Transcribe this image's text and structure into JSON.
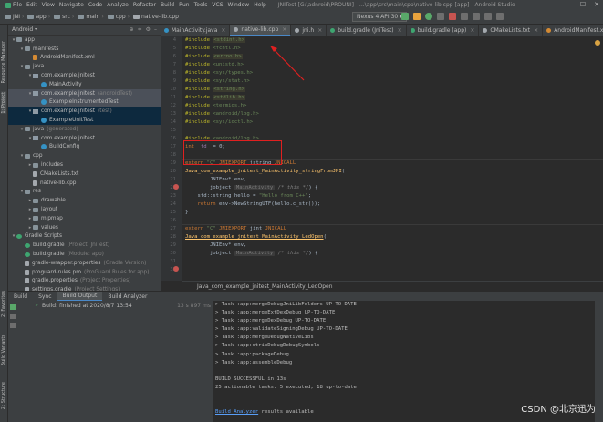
{
  "menubar": {
    "items": [
      "File",
      "Edit",
      "View",
      "Navigate",
      "Code",
      "Analyze",
      "Refactor",
      "Build",
      "Run",
      "Tools",
      "VCS",
      "Window",
      "Help"
    ],
    "title": "JNITest [G:\\adnroid\\PROUNI] - ...\\app\\src\\main\\cpp\\native-lib.cpp [app] - Android Studio"
  },
  "navbar": {
    "crumbs": [
      "JNI",
      "app",
      "src",
      "main",
      "cpp",
      "native-lib.cpp"
    ],
    "device": "Nexus 4 API 30 ▾"
  },
  "left_strip": [
    "Resource Manager",
    "1: Project",
    "2: Favorites",
    "Build Variants",
    "Z: Structure"
  ],
  "project": {
    "header": "Android ▾",
    "tree": [
      {
        "indent": 0,
        "arrow": "▾",
        "icon": "folder",
        "label": "app",
        "extra": ""
      },
      {
        "indent": 1,
        "arrow": "▾",
        "icon": "folder",
        "label": "manifests",
        "extra": ""
      },
      {
        "indent": 2,
        "arrow": "",
        "icon": "xml",
        "label": "AndroidManifest.xml",
        "extra": ""
      },
      {
        "indent": 1,
        "arrow": "▾",
        "icon": "folder",
        "label": "java",
        "extra": ""
      },
      {
        "indent": 2,
        "arrow": "▾",
        "icon": "pkg",
        "label": "com.example.jnitest",
        "extra": ""
      },
      {
        "indent": 3,
        "arrow": "",
        "icon": "cls",
        "label": "MainActivity",
        "extra": ""
      },
      {
        "indent": 2,
        "arrow": "▾",
        "icon": "pkg",
        "label": "com.example.jnitest",
        "extra": "(androidTest)",
        "hl": true
      },
      {
        "indent": 3,
        "arrow": "",
        "icon": "cls",
        "label": "ExampleInstrumentedTest",
        "extra": "",
        "hl": true
      },
      {
        "indent": 2,
        "arrow": "▾",
        "icon": "pkg",
        "label": "com.example.jnitest",
        "extra": "(test)",
        "sel": true
      },
      {
        "indent": 3,
        "arrow": "",
        "icon": "cls",
        "label": "ExampleUnitTest",
        "extra": "",
        "sel": true
      },
      {
        "indent": 1,
        "arrow": "▾",
        "icon": "folder",
        "label": "java",
        "extra": "(generated)"
      },
      {
        "indent": 2,
        "arrow": "▾",
        "icon": "pkg",
        "label": "com.example.jnitest",
        "extra": ""
      },
      {
        "indent": 3,
        "arrow": "",
        "icon": "cls",
        "label": "BuildConfig",
        "extra": ""
      },
      {
        "indent": 1,
        "arrow": "▾",
        "icon": "folder",
        "label": "cpp",
        "extra": ""
      },
      {
        "indent": 2,
        "arrow": "▸",
        "icon": "folder",
        "label": "includes",
        "extra": ""
      },
      {
        "indent": 2,
        "arrow": "",
        "icon": "file",
        "label": "CMakeLists.txt",
        "extra": ""
      },
      {
        "indent": 2,
        "arrow": "",
        "icon": "file",
        "label": "native-lib.cpp",
        "extra": ""
      },
      {
        "indent": 1,
        "arrow": "▾",
        "icon": "folder",
        "label": "res",
        "extra": ""
      },
      {
        "indent": 2,
        "arrow": "▸",
        "icon": "folder",
        "label": "drawable",
        "extra": ""
      },
      {
        "indent": 2,
        "arrow": "▸",
        "icon": "folder",
        "label": "layout",
        "extra": ""
      },
      {
        "indent": 2,
        "arrow": "▸",
        "icon": "folder",
        "label": "mipmap",
        "extra": ""
      },
      {
        "indent": 2,
        "arrow": "▸",
        "icon": "folder",
        "label": "values",
        "extra": ""
      },
      {
        "indent": 0,
        "arrow": "▾",
        "icon": "gradle",
        "label": "Gradle Scripts",
        "extra": ""
      },
      {
        "indent": 1,
        "arrow": "",
        "icon": "gradle",
        "label": "build.gradle",
        "extra": "(Project: JniTest)"
      },
      {
        "indent": 1,
        "arrow": "",
        "icon": "gradle",
        "label": "build.gradle",
        "extra": "(Module: app)"
      },
      {
        "indent": 1,
        "arrow": "",
        "icon": "file",
        "label": "gradle-wrapper.properties",
        "extra": "(Gradle Version)"
      },
      {
        "indent": 1,
        "arrow": "",
        "icon": "file",
        "label": "proguard-rules.pro",
        "extra": "(ProGuard Rules for app)"
      },
      {
        "indent": 1,
        "arrow": "",
        "icon": "file",
        "label": "gradle.properties",
        "extra": "(Project Properties)"
      },
      {
        "indent": 1,
        "arrow": "",
        "icon": "file",
        "label": "settings.gradle",
        "extra": "(Project Settings)"
      }
    ]
  },
  "tabs": [
    {
      "label": "MainActivity.java",
      "color": "#3592c4",
      "active": false
    },
    {
      "label": "native-lib.cpp",
      "color": "#a3a8ad",
      "active": true
    },
    {
      "label": "jni.h",
      "color": "#a3a8ad",
      "active": false
    },
    {
      "label": "build.gradle (JniTest)",
      "color": "#3ea570",
      "active": false
    },
    {
      "label": "build.gradle (app)",
      "color": "#3ea570",
      "active": false
    },
    {
      "label": "CMakeLists.txt",
      "color": "#a3a8ad",
      "active": false
    },
    {
      "label": "AndroidManifest.xm",
      "color": "#d48a33",
      "active": false
    }
  ],
  "line_numbers": [
    "4",
    "5",
    "6",
    "7",
    "8",
    "9",
    "10",
    "11",
    "12",
    "13",
    "14",
    "15",
    "16",
    "17",
    "18",
    "19",
    "20",
    "21",
    "22",
    "23",
    "24",
    "25",
    "26",
    "27",
    "28",
    "29",
    "30",
    "31",
    "32"
  ],
  "code": [
    [
      [
        "pp",
        "#include "
      ],
      [
        "incbox",
        "<stdint.h>"
      ]
    ],
    [
      [
        "pp",
        "#include "
      ],
      [
        "inc",
        "<fcntl.h>"
      ]
    ],
    [
      [
        "pp",
        "#include "
      ],
      [
        "incbox",
        "<errno.h>"
      ]
    ],
    [
      [
        "pp",
        "#include "
      ],
      [
        "inc",
        "<unistd.h>"
      ]
    ],
    [
      [
        "pp",
        "#include "
      ],
      [
        "inc",
        "<sys/types.h>"
      ]
    ],
    [
      [
        "pp",
        "#include "
      ],
      [
        "inc",
        "<sys/stat.h>"
      ]
    ],
    [
      [
        "pp",
        "#include "
      ],
      [
        "incbox",
        "<string.h>"
      ]
    ],
    [
      [
        "pp",
        "#include "
      ],
      [
        "incbox",
        "<stdlib.h>"
      ]
    ],
    [
      [
        "pp",
        "#include "
      ],
      [
        "inc",
        "<termios.h>"
      ]
    ],
    [
      [
        "pp",
        "#include "
      ],
      [
        "inc",
        "<android/log.h>"
      ]
    ],
    [
      [
        "pp",
        "#include "
      ],
      [
        "inc",
        "<sys/ioctl.h>"
      ]
    ],
    [],
    [
      [
        "pp",
        "#include "
      ],
      [
        "inc",
        "<android/log.h>"
      ]
    ],
    [
      [
        "kw",
        "int  "
      ],
      [
        "purple",
        "fd"
      ],
      [
        "",
        "  = 0;"
      ]
    ],
    [],
    [
      [
        "kw",
        "extern "
      ],
      [
        "str",
        "\"C\" "
      ],
      [
        "kw",
        "JNIEXPORT "
      ],
      [
        "",
        "jstring "
      ],
      [
        "kw",
        "JNICALL"
      ]
    ],
    [
      [
        "fn",
        "Java_com_example_jnitest_MainActivity_stringFromJNI"
      ],
      [
        "",
        "("
      ]
    ],
    [
      [
        "",
        "        JNIEnv* env,"
      ]
    ],
    [
      [
        "",
        "        jobject "
      ],
      [
        "hint",
        "MainActivity"
      ],
      [
        "cmt",
        " /* this */"
      ],
      [
        "",
        ") {"
      ]
    ],
    [
      [
        "",
        "    std::string hello = "
      ],
      [
        "str",
        "\"Hello from C++\""
      ],
      [
        "",
        ";"
      ]
    ],
    [
      [
        "kw",
        "    return "
      ],
      [
        "",
        "env->NewStringUTF(hello.c_str());"
      ]
    ],
    [
      [
        "",
        "}"
      ]
    ],
    [],
    [
      [
        "kw",
        "extern "
      ],
      [
        "str",
        "\"C\" "
      ],
      [
        "kw",
        "JNIEXPORT "
      ],
      [
        "",
        "jint "
      ],
      [
        "kw",
        "JNICALL"
      ]
    ],
    [
      [
        "ulfn",
        "Java_com_example_jnitest_MainActivity_LedOpen"
      ],
      [
        "",
        "("
      ]
    ],
    [
      [
        "",
        "        JNIEnv* env,"
      ]
    ],
    [
      [
        "",
        "        jobject "
      ],
      [
        "hint",
        "MainActivity"
      ],
      [
        "cmt",
        " /* this */"
      ],
      [
        "",
        ") {"
      ]
    ],
    [],
    []
  ],
  "editor_breadcrumb": "Java_com_example_jnitest_MainActivity_LedOpen",
  "bottom_tabs": [
    "Build",
    "Sync",
    "Build Output",
    "Build Analyzer"
  ],
  "build_status": {
    "text": "Build: finished at 2020/8/7 13:54",
    "duration": "13 s 897 ms"
  },
  "output_lines": [
    "> Task :app:mergeDebugJniLibFolders UP-TO-DATE",
    "> Task :app:mergeExtDexDebug UP-TO-DATE",
    "> Task :app:mergeDexDebug UP-TO-DATE",
    "> Task :app:validateSigningDebug UP-TO-DATE",
    "> Task :app:mergeDebugNativeLibs",
    "> Task :app:stripDebugDebugSymbols",
    "> Task :app:packageDebug",
    "> Task :app:assembleDebug",
    "",
    "BUILD SUCCESSFUL in 13s",
    "25 actionable tasks: 5 executed, 18 up-to-date",
    "",
    ""
  ],
  "analyzer_link": {
    "link": "Build Analyzer",
    "rest": " results available"
  },
  "watermark": "CSDN @北京迅为"
}
